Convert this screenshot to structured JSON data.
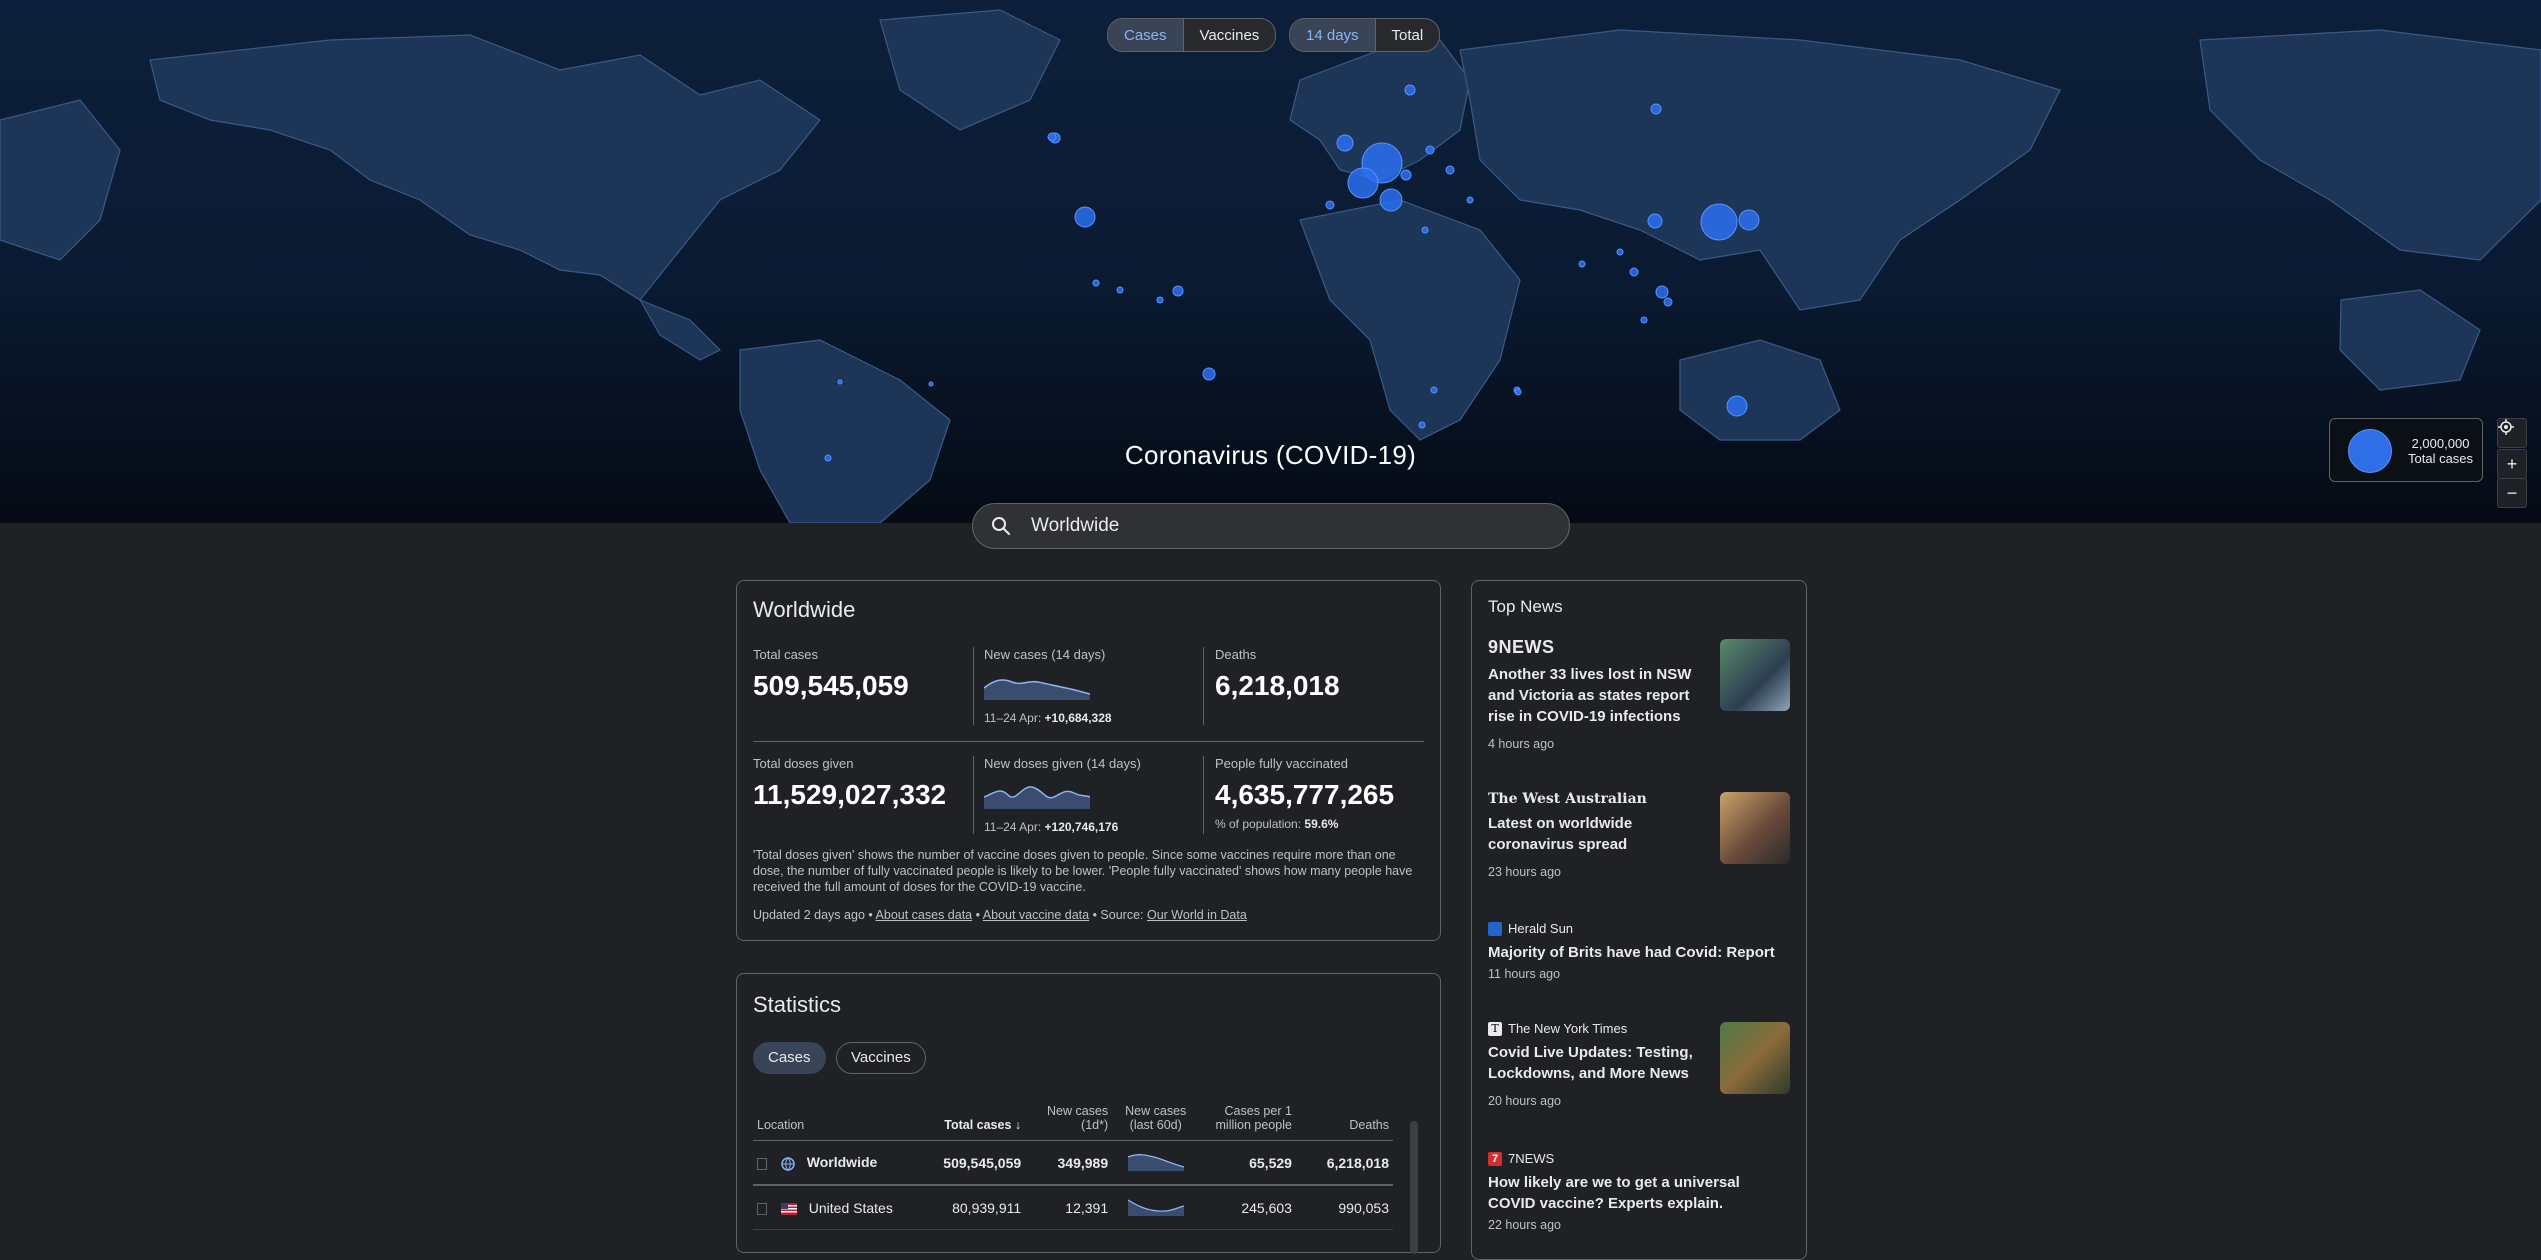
{
  "map": {
    "toggle_metric": [
      "Cases",
      "Vaccines"
    ],
    "toggle_period": [
      "14 days",
      "Total"
    ],
    "title": "Coronavirus (COVID-19)",
    "legend_value": "2,000,000",
    "legend_label": "Total cases"
  },
  "search": {
    "placeholder": "Worldwide"
  },
  "summary": {
    "title": "Worldwide",
    "total_cases_label": "Total cases",
    "total_cases": "509,545,059",
    "new_cases_label": "New cases (14 days)",
    "new_cases_range": "11–24 Apr:",
    "new_cases_delta": "+10,684,328",
    "deaths_label": "Deaths",
    "deaths": "6,218,018",
    "doses_label": "Total doses given",
    "doses": "11,529,027,332",
    "new_doses_label": "New doses given (14 days)",
    "new_doses_range": "11–24 Apr:",
    "new_doses_delta": "+120,746,176",
    "vaccinated_label": "People fully vaccinated",
    "vaccinated": "4,635,777,265",
    "population_label": "% of population:",
    "population_pct": "59.6%",
    "note": "'Total doses given' shows the number of vaccine doses given to people. Since some vaccines require more than one dose, the number of fully vaccinated people is likely to be lower. 'People fully vaccinated' shows how many people have received the full amount of doses for the COVID-19 vaccine.",
    "updated": "Updated 2 days ago",
    "sep1": " • ",
    "link_cases": "About cases data",
    "sep2": " • ",
    "link_vaccine": "About vaccine data",
    "source_prefix": " • Source: ",
    "link_source": "Our World in Data"
  },
  "statistics": {
    "title": "Statistics",
    "tabs": [
      "Cases",
      "Vaccines"
    ],
    "headers": [
      "Location",
      "Total cases",
      "New cases (1d*)",
      "New cases (last 60d)",
      "Cases per 1 million people",
      "Deaths"
    ],
    "rows": [
      {
        "location": "Worldwide",
        "total": "509,545,059",
        "new": "349,989",
        "per_million": "65,529",
        "deaths": "6,218,018"
      },
      {
        "location": "United States",
        "total": "80,939,911",
        "new": "12,391",
        "per_million": "245,603",
        "deaths": "990,053"
      }
    ]
  },
  "news": {
    "title": "Top News",
    "items": [
      {
        "source": "9NEWS",
        "title": "Another 33 lives lost in NSW and Victoria as states report rise in COVID-19 infections",
        "time": "4 hours ago"
      },
      {
        "source": "The West Australian",
        "title": "Latest on worldwide coronavirus spread",
        "time": "23 hours ago"
      },
      {
        "source": "Herald Sun",
        "title": "Majority of Brits have had Covid: Report",
        "time": "11 hours ago"
      },
      {
        "source": "The New York Times",
        "title": "Covid Live Updates: Testing, Lockdowns, and More News",
        "time": "20 hours ago"
      },
      {
        "source": "7NEWS",
        "title": "How likely are we to get a universal COVID vaccine? Experts explain.",
        "time": "22 hours ago"
      }
    ]
  },
  "colors": {
    "accent": "#8ab4f8",
    "bubble": "#2e6ee6",
    "land": "#1d3658",
    "ocean": "#0b1a30",
    "background": "#202124"
  },
  "icons": [
    "search-icon",
    "globe-icon",
    "us-flag-icon",
    "sort-down-icon",
    "locate-icon",
    "zoom-in-icon",
    "zoom-out-icon"
  ]
}
